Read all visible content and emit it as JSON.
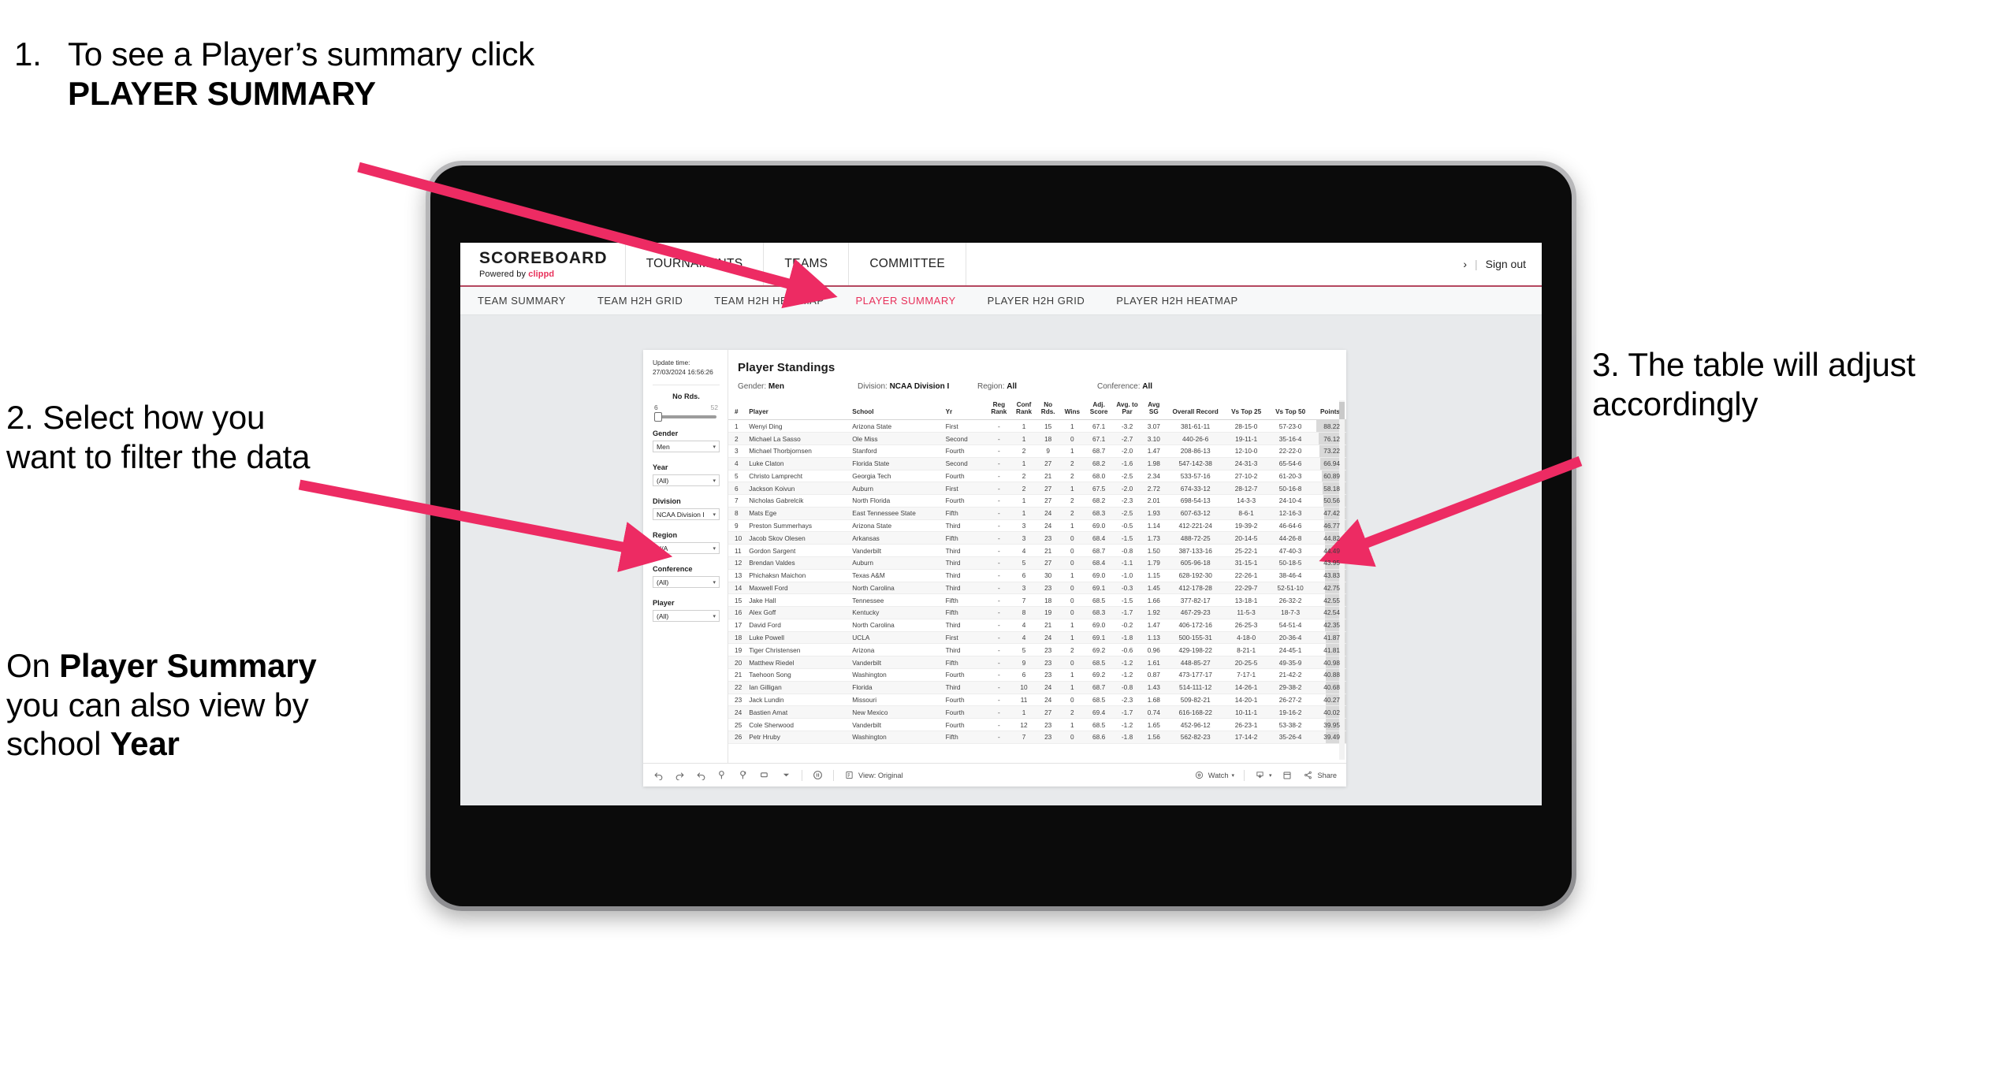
{
  "annotations": {
    "step1": {
      "number": "1.",
      "text_before": "To see a Player’s summary click ",
      "bold": "PLAYER SUMMARY"
    },
    "step2": {
      "text": "2. Select how you want to filter the data"
    },
    "step3_line": {
      "prefix": "On ",
      "bold1": "Player Summary",
      "mid": " you can also view by school ",
      "bold2": "Year"
    },
    "step4": {
      "text": "3. The table will adjust accordingly"
    },
    "arrow_color": "#ED2B63"
  },
  "app": {
    "brand": {
      "title": "SCOREBOARD",
      "powered_prefix": "Powered by ",
      "powered_name": "clippd"
    },
    "topnav": [
      {
        "label": "TOURNAMENTS"
      },
      {
        "label": "TEAMS"
      },
      {
        "label": "COMMITTEE"
      }
    ],
    "topbar_right": {
      "chevron": "›",
      "divider": "|",
      "sign_out": "Sign out"
    },
    "subnav": [
      {
        "label": "TEAM SUMMARY",
        "active": false
      },
      {
        "label": "TEAM H2H GRID",
        "active": false
      },
      {
        "label": "TEAM H2H HEATMAP",
        "active": false
      },
      {
        "label": "PLAYER SUMMARY",
        "active": true
      },
      {
        "label": "PLAYER H2H GRID",
        "active": false
      },
      {
        "label": "PLAYER H2H HEATMAP",
        "active": false
      }
    ],
    "accent_color": "#E8305A"
  },
  "filters": {
    "update_time_label": "Update time:",
    "update_time_value": "27/03/2024 16:56:26",
    "no_rds": {
      "title": "No Rds.",
      "min": "6",
      "max": "52"
    },
    "gender": {
      "title": "Gender",
      "value": "Men"
    },
    "year": {
      "title": "Year",
      "value": "(All)"
    },
    "division": {
      "title": "Division",
      "value": "NCAA Division I"
    },
    "region": {
      "title": "Region",
      "value": "N/A"
    },
    "conference": {
      "title": "Conference",
      "value": "(All)"
    },
    "player": {
      "title": "Player",
      "value": "(All)"
    }
  },
  "viz": {
    "title": "Player Standings",
    "filter_line": [
      {
        "label": "Gender:",
        "value": "Men"
      },
      {
        "label": "Division:",
        "value": "NCAA Division I"
      },
      {
        "label": "Region:",
        "value": "All"
      },
      {
        "label": "Conference:",
        "value": "All"
      }
    ],
    "columns": [
      {
        "key": "num",
        "label": "#"
      },
      {
        "key": "player",
        "label": "Player"
      },
      {
        "key": "school",
        "label": "School"
      },
      {
        "key": "yr",
        "label": "Yr"
      },
      {
        "key": "reg",
        "label": "Reg Rank"
      },
      {
        "key": "conf",
        "label": "Conf Rank"
      },
      {
        "key": "rds",
        "label": "No Rds."
      },
      {
        "key": "wins",
        "label": "Wins"
      },
      {
        "key": "adj",
        "label": "Adj. Score"
      },
      {
        "key": "par",
        "label": "Avg. to Par"
      },
      {
        "key": "sg",
        "label": "Avg SG"
      },
      {
        "key": "rec",
        "label": "Overall Record"
      },
      {
        "key": "t25",
        "label": "Vs Top 25"
      },
      {
        "key": "t50",
        "label": "Vs Top 50"
      },
      {
        "key": "pts",
        "label": "Points"
      }
    ],
    "rows": [
      {
        "num": "1",
        "player": "Wenyi Ding",
        "school": "Arizona State",
        "yr": "First",
        "reg": "-",
        "conf": "1",
        "rds": "15",
        "wins": "1",
        "adj": "67.1",
        "par": "-3.2",
        "sg": "3.07",
        "rec": "381-61-11",
        "t25": "28-15-0",
        "t50": "57-23-0",
        "pts": "88.22"
      },
      {
        "num": "2",
        "player": "Michael La Sasso",
        "school": "Ole Miss",
        "yr": "Second",
        "reg": "-",
        "conf": "1",
        "rds": "18",
        "wins": "0",
        "adj": "67.1",
        "par": "-2.7",
        "sg": "3.10",
        "rec": "440-26-6",
        "t25": "19-11-1",
        "t50": "35-16-4",
        "pts": "76.12"
      },
      {
        "num": "3",
        "player": "Michael Thorbjornsen",
        "school": "Stanford",
        "yr": "Fourth",
        "reg": "-",
        "conf": "2",
        "rds": "9",
        "wins": "1",
        "adj": "68.7",
        "par": "-2.0",
        "sg": "1.47",
        "rec": "208-86-13",
        "t25": "12-10-0",
        "t50": "22-22-0",
        "pts": "73.22"
      },
      {
        "num": "4",
        "player": "Luke Claton",
        "school": "Florida State",
        "yr": "Second",
        "reg": "-",
        "conf": "1",
        "rds": "27",
        "wins": "2",
        "adj": "68.2",
        "par": "-1.6",
        "sg": "1.98",
        "rec": "547-142-38",
        "t25": "24-31-3",
        "t50": "65-54-6",
        "pts": "66.94"
      },
      {
        "num": "5",
        "player": "Christo Lamprecht",
        "school": "Georgia Tech",
        "yr": "Fourth",
        "reg": "-",
        "conf": "2",
        "rds": "21",
        "wins": "2",
        "adj": "68.0",
        "par": "-2.5",
        "sg": "2.34",
        "rec": "533-57-16",
        "t25": "27-10-2",
        "t50": "61-20-3",
        "pts": "60.89"
      },
      {
        "num": "6",
        "player": "Jackson Koivun",
        "school": "Auburn",
        "yr": "First",
        "reg": "-",
        "conf": "2",
        "rds": "27",
        "wins": "1",
        "adj": "67.5",
        "par": "-2.0",
        "sg": "2.72",
        "rec": "674-33-12",
        "t25": "28-12-7",
        "t50": "50-16-8",
        "pts": "58.18"
      },
      {
        "num": "7",
        "player": "Nicholas Gabrelcik",
        "school": "North Florida",
        "yr": "Fourth",
        "reg": "-",
        "conf": "1",
        "rds": "27",
        "wins": "2",
        "adj": "68.2",
        "par": "-2.3",
        "sg": "2.01",
        "rec": "698-54-13",
        "t25": "14-3-3",
        "t50": "24-10-4",
        "pts": "50.56"
      },
      {
        "num": "8",
        "player": "Mats Ege",
        "school": "East Tennessee State",
        "yr": "Fifth",
        "reg": "-",
        "conf": "1",
        "rds": "24",
        "wins": "2",
        "adj": "68.3",
        "par": "-2.5",
        "sg": "1.93",
        "rec": "607-63-12",
        "t25": "8-6-1",
        "t50": "12-16-3",
        "pts": "47.42"
      },
      {
        "num": "9",
        "player": "Preston Summerhays",
        "school": "Arizona State",
        "yr": "Third",
        "reg": "-",
        "conf": "3",
        "rds": "24",
        "wins": "1",
        "adj": "69.0",
        "par": "-0.5",
        "sg": "1.14",
        "rec": "412-221-24",
        "t25": "19-39-2",
        "t50": "46-64-6",
        "pts": "46.77"
      },
      {
        "num": "10",
        "player": "Jacob Skov Olesen",
        "school": "Arkansas",
        "yr": "Fifth",
        "reg": "-",
        "conf": "3",
        "rds": "23",
        "wins": "0",
        "adj": "68.4",
        "par": "-1.5",
        "sg": "1.73",
        "rec": "488-72-25",
        "t25": "20-14-5",
        "t50": "44-26-8",
        "pts": "44.82"
      },
      {
        "num": "11",
        "player": "Gordon Sargent",
        "school": "Vanderbilt",
        "yr": "Third",
        "reg": "-",
        "conf": "4",
        "rds": "21",
        "wins": "0",
        "adj": "68.7",
        "par": "-0.8",
        "sg": "1.50",
        "rec": "387-133-16",
        "t25": "25-22-1",
        "t50": "47-40-3",
        "pts": "44.49"
      },
      {
        "num": "12",
        "player": "Brendan Valdes",
        "school": "Auburn",
        "yr": "Third",
        "reg": "-",
        "conf": "5",
        "rds": "27",
        "wins": "0",
        "adj": "68.4",
        "par": "-1.1",
        "sg": "1.79",
        "rec": "605-96-18",
        "t25": "31-15-1",
        "t50": "50-18-5",
        "pts": "43.95"
      },
      {
        "num": "13",
        "player": "Phichaksn Maichon",
        "school": "Texas A&M",
        "yr": "Third",
        "reg": "-",
        "conf": "6",
        "rds": "30",
        "wins": "1",
        "adj": "69.0",
        "par": "-1.0",
        "sg": "1.15",
        "rec": "628-192-30",
        "t25": "22-26-1",
        "t50": "38-46-4",
        "pts": "43.83"
      },
      {
        "num": "14",
        "player": "Maxwell Ford",
        "school": "North Carolina",
        "yr": "Third",
        "reg": "-",
        "conf": "3",
        "rds": "23",
        "wins": "0",
        "adj": "69.1",
        "par": "-0.3",
        "sg": "1.45",
        "rec": "412-178-28",
        "t25": "22-29-7",
        "t50": "52-51-10",
        "pts": "42.75"
      },
      {
        "num": "15",
        "player": "Jake Hall",
        "school": "Tennessee",
        "yr": "Fifth",
        "reg": "-",
        "conf": "7",
        "rds": "18",
        "wins": "0",
        "adj": "68.5",
        "par": "-1.5",
        "sg": "1.66",
        "rec": "377-82-17",
        "t25": "13-18-1",
        "t50": "26-32-2",
        "pts": "42.55"
      },
      {
        "num": "16",
        "player": "Alex Goff",
        "school": "Kentucky",
        "yr": "Fifth",
        "reg": "-",
        "conf": "8",
        "rds": "19",
        "wins": "0",
        "adj": "68.3",
        "par": "-1.7",
        "sg": "1.92",
        "rec": "467-29-23",
        "t25": "11-5-3",
        "t50": "18-7-3",
        "pts": "42.54"
      },
      {
        "num": "17",
        "player": "David Ford",
        "school": "North Carolina",
        "yr": "Third",
        "reg": "-",
        "conf": "4",
        "rds": "21",
        "wins": "1",
        "adj": "69.0",
        "par": "-0.2",
        "sg": "1.47",
        "rec": "406-172-16",
        "t25": "26-25-3",
        "t50": "54-51-4",
        "pts": "42.35"
      },
      {
        "num": "18",
        "player": "Luke Powell",
        "school": "UCLA",
        "yr": "First",
        "reg": "-",
        "conf": "4",
        "rds": "24",
        "wins": "1",
        "adj": "69.1",
        "par": "-1.8",
        "sg": "1.13",
        "rec": "500-155-31",
        "t25": "4-18-0",
        "t50": "20-36-4",
        "pts": "41.87"
      },
      {
        "num": "19",
        "player": "Tiger Christensen",
        "school": "Arizona",
        "yr": "Third",
        "reg": "-",
        "conf": "5",
        "rds": "23",
        "wins": "2",
        "adj": "69.2",
        "par": "-0.6",
        "sg": "0.96",
        "rec": "429-198-22",
        "t25": "8-21-1",
        "t50": "24-45-1",
        "pts": "41.81"
      },
      {
        "num": "20",
        "player": "Matthew Riedel",
        "school": "Vanderbilt",
        "yr": "Fifth",
        "reg": "-",
        "conf": "9",
        "rds": "23",
        "wins": "0",
        "adj": "68.5",
        "par": "-1.2",
        "sg": "1.61",
        "rec": "448-85-27",
        "t25": "20-25-5",
        "t50": "49-35-9",
        "pts": "40.98"
      },
      {
        "num": "21",
        "player": "Taehoon Song",
        "school": "Washington",
        "yr": "Fourth",
        "reg": "-",
        "conf": "6",
        "rds": "23",
        "wins": "1",
        "adj": "69.2",
        "par": "-1.2",
        "sg": "0.87",
        "rec": "473-177-17",
        "t25": "7-17-1",
        "t50": "21-42-2",
        "pts": "40.88"
      },
      {
        "num": "22",
        "player": "Ian Gilligan",
        "school": "Florida",
        "yr": "Third",
        "reg": "-",
        "conf": "10",
        "rds": "24",
        "wins": "1",
        "adj": "68.7",
        "par": "-0.8",
        "sg": "1.43",
        "rec": "514-111-12",
        "t25": "14-26-1",
        "t50": "29-38-2",
        "pts": "40.68"
      },
      {
        "num": "23",
        "player": "Jack Lundin",
        "school": "Missouri",
        "yr": "Fourth",
        "reg": "-",
        "conf": "11",
        "rds": "24",
        "wins": "0",
        "adj": "68.5",
        "par": "-2.3",
        "sg": "1.68",
        "rec": "509-82-21",
        "t25": "14-20-1",
        "t50": "26-27-2",
        "pts": "40.27"
      },
      {
        "num": "24",
        "player": "Bastien Amat",
        "school": "New Mexico",
        "yr": "Fourth",
        "reg": "-",
        "conf": "1",
        "rds": "27",
        "wins": "2",
        "adj": "69.4",
        "par": "-1.7",
        "sg": "0.74",
        "rec": "616-168-22",
        "t25": "10-11-1",
        "t50": "19-16-2",
        "pts": "40.02"
      },
      {
        "num": "25",
        "player": "Cole Sherwood",
        "school": "Vanderbilt",
        "yr": "Fourth",
        "reg": "-",
        "conf": "12",
        "rds": "23",
        "wins": "1",
        "adj": "68.5",
        "par": "-1.2",
        "sg": "1.65",
        "rec": "452-96-12",
        "t25": "26-23-1",
        "t50": "53-38-2",
        "pts": "39.95"
      },
      {
        "num": "26",
        "player": "Petr Hruby",
        "school": "Washington",
        "yr": "Fifth",
        "reg": "-",
        "conf": "7",
        "rds": "23",
        "wins": "0",
        "adj": "68.6",
        "par": "-1.8",
        "sg": "1.56",
        "rec": "562-82-23",
        "t25": "17-14-2",
        "t50": "35-26-4",
        "pts": "39.49"
      }
    ]
  },
  "toolbar": {
    "view_label": "View: Original",
    "watch_label": "Watch",
    "share_label": "Share"
  }
}
